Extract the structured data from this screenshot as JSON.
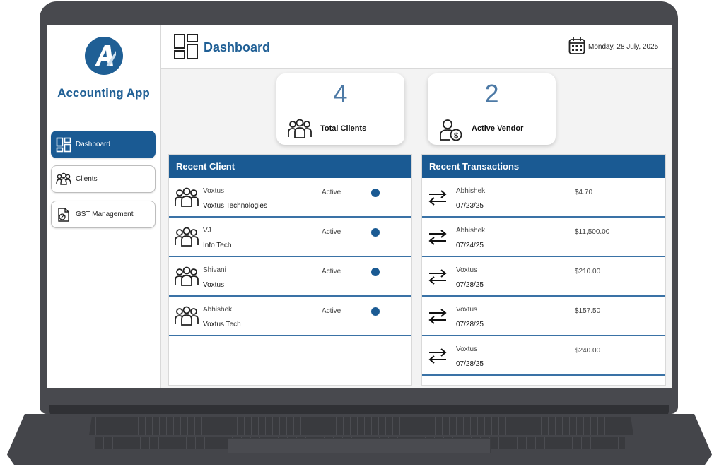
{
  "app": {
    "name": "Accounting App",
    "logo_letter": "A",
    "brand_color": "#1f5f95"
  },
  "sidebar": {
    "items": [
      {
        "label": "Dashboard",
        "icon": "dashboard-grid-icon",
        "active": true
      },
      {
        "label": "Clients",
        "icon": "users-icon",
        "active": false
      },
      {
        "label": "GST Management",
        "icon": "document-tax-icon",
        "active": false
      }
    ]
  },
  "header": {
    "title": "Dashboard",
    "date": "Monday, 28 July, 2025",
    "title_icon": "dashboard-grid-icon",
    "date_icon": "calendar-icon"
  },
  "stats": [
    {
      "value": "4",
      "label": "Total Clients",
      "icon": "users-icon"
    },
    {
      "value": "2",
      "label": "Active Vendor",
      "icon": "vendor-dollar-icon"
    }
  ],
  "recent_clients": {
    "title": "Recent Client",
    "rows": [
      {
        "name": "Voxtus",
        "company": "Voxtus Technologies",
        "status": "Active",
        "status_color": "#1a5a93"
      },
      {
        "name": "VJ",
        "company": "Info Tech",
        "status": "Active",
        "status_color": "#1a5a93"
      },
      {
        "name": "Shivani",
        "company": "Voxtus",
        "status": "Active",
        "status_color": "#1a5a93"
      },
      {
        "name": "Abhishek",
        "company": "Voxtus Tech",
        "status": "Active",
        "status_color": "#1a5a93"
      }
    ]
  },
  "recent_transactions": {
    "title": "Recent Transactions",
    "rows": [
      {
        "name": "Abhishek",
        "date": "07/23/25",
        "amount": "$4.70"
      },
      {
        "name": "Abhishek",
        "date": "07/24/25",
        "amount": "$11,500.00"
      },
      {
        "name": "Voxtus",
        "date": "07/28/25",
        "amount": "$210.00"
      },
      {
        "name": "Voxtus",
        "date": "07/28/25",
        "amount": "$157.50"
      },
      {
        "name": "Voxtus",
        "date": "07/28/25",
        "amount": "$240.00"
      }
    ]
  }
}
